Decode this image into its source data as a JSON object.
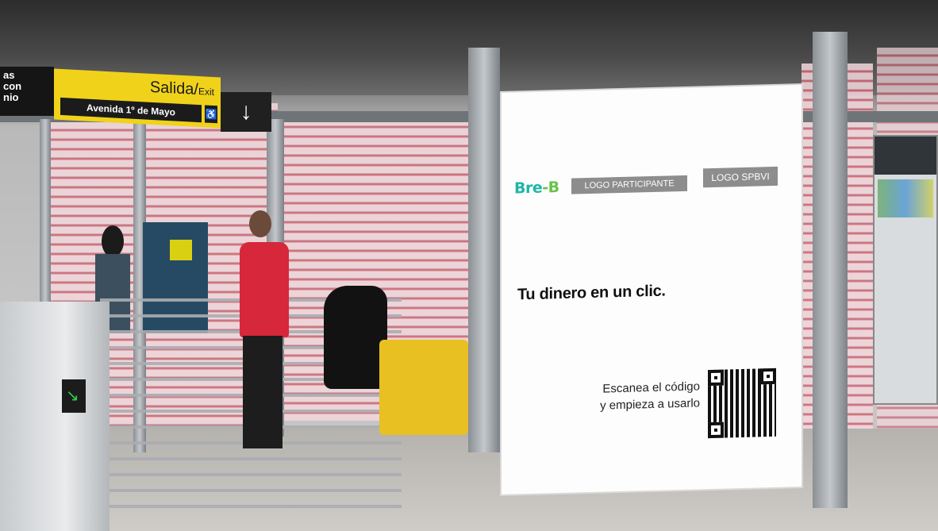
{
  "station_sign": {
    "left_fragment": "as\ncon\nnio",
    "salida": "Salida",
    "exit": "Exit",
    "street": "Avenida 1º de Mayo",
    "arrow": "↓"
  },
  "billboard": {
    "brand": {
      "part1": "Bre",
      "part2": "-B"
    },
    "logo_participante": "LOGO PARTICIPANTE",
    "logo_spbvi": "LOGO SPBVI",
    "headline": "Tu dinero en un clic.",
    "scan_line1": "Escanea el código",
    "scan_line2": "y empieza a usarlo",
    "qr_icon": "qr-code-icon"
  },
  "colors": {
    "brand_teal": "#1fb6a6",
    "brand_green": "#6ac24b",
    "sign_yellow": "#f0d21a",
    "logo_gray": "#8d8d8d"
  }
}
